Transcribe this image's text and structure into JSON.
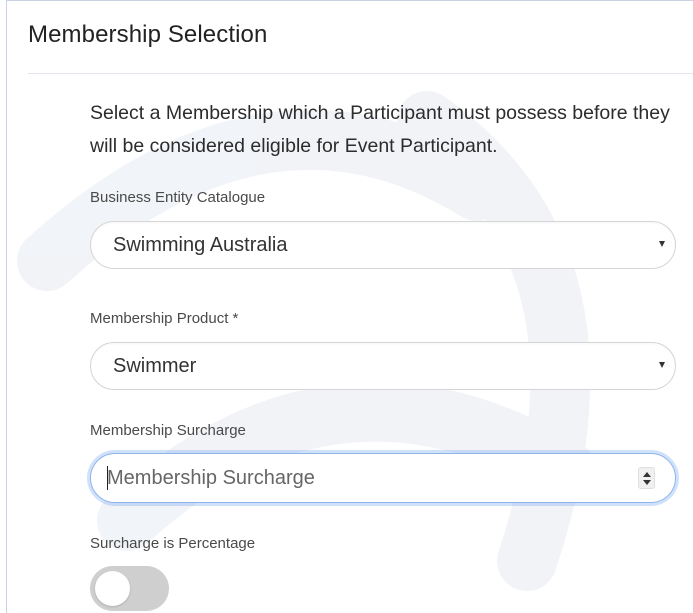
{
  "panel": {
    "title": "Membership Selection",
    "description": "Select a Membership which a Participant must possess before they will be considered eligible for Event Participant."
  },
  "fields": {
    "catalogue": {
      "label": "Business Entity Catalogue",
      "value": "Swimming Australia"
    },
    "product": {
      "label": "Membership Product *",
      "value": "Swimmer"
    },
    "surcharge": {
      "label": "Membership Surcharge",
      "placeholder": "Membership Surcharge",
      "value": ""
    },
    "surcharge_percentage": {
      "label": "Surcharge is Percentage",
      "checked": false
    }
  },
  "icons": {
    "select_caret": "caret-down-icon",
    "spinner": "spinner-icon"
  },
  "colors": {
    "focus_ring": "#8db4ea",
    "toggle_off": "#cfcfcf"
  }
}
